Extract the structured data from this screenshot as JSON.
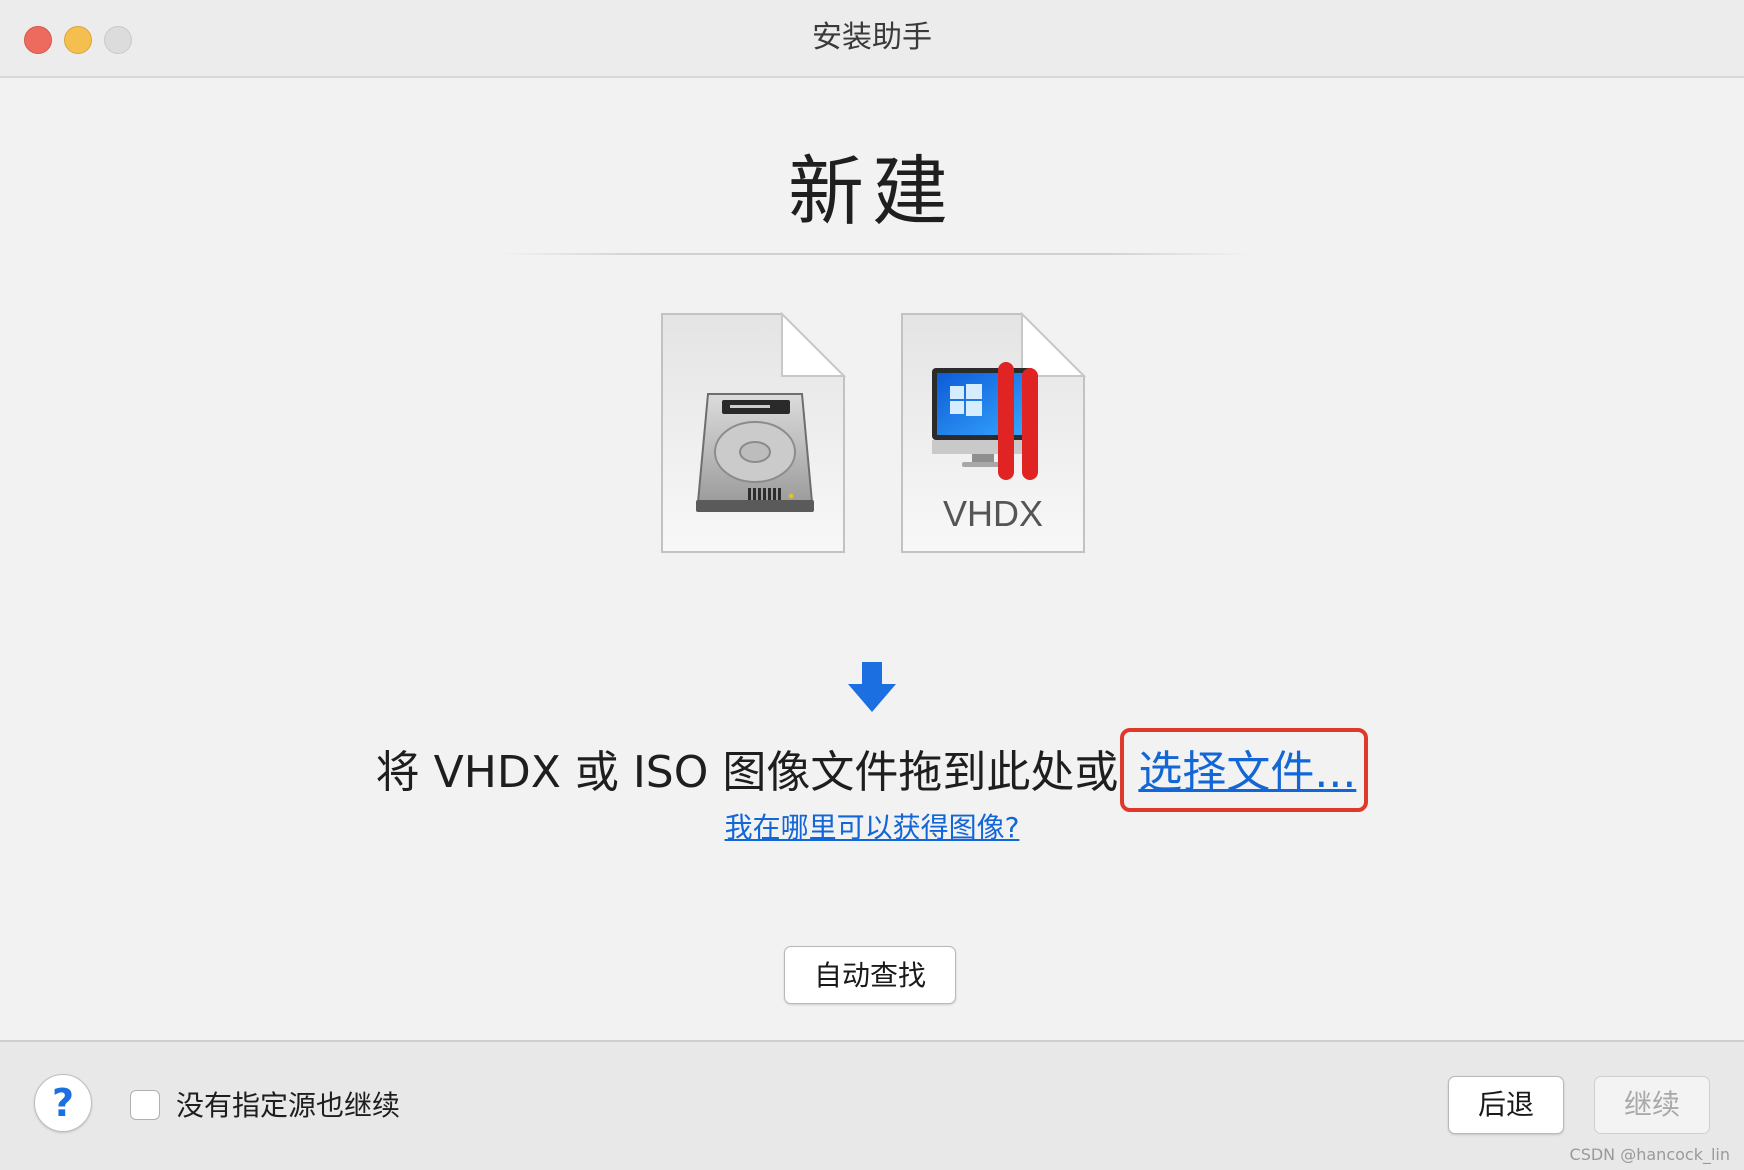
{
  "window": {
    "title": "安装助手"
  },
  "main": {
    "heading": "新建",
    "file_icons": [
      {
        "name": "hard-disk-image-icon",
        "label": ""
      },
      {
        "name": "vhdx-file-icon",
        "label": "VHDX"
      }
    ],
    "instruction_text": "将 VHDX 或 ISO 图像文件拖到此处或",
    "choose_file_link": "选择文件...",
    "where_link": "我在哪里可以获得图像?",
    "auto_find_button": "自动查找"
  },
  "footer": {
    "help_label": "?",
    "checkbox_label": "没有指定源也继续",
    "checkbox_checked": false,
    "back_button": "后退",
    "continue_button": "继续",
    "continue_enabled": false
  },
  "watermark": "CSDN @hancock_lin",
  "colors": {
    "link": "#1366d6",
    "highlight_border": "#e0392b",
    "arrow": "#1b6fe0",
    "parallels_red": "#e02323"
  }
}
